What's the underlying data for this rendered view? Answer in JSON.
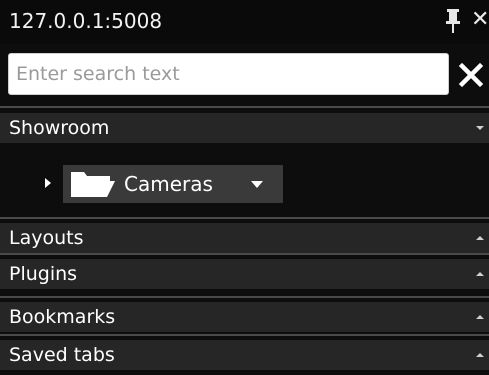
{
  "window": {
    "title": "127.0.0.1:5008",
    "close_glyph": "✕"
  },
  "search": {
    "placeholder": "Enter search text",
    "value": ""
  },
  "sections": {
    "showroom": {
      "label": "Showroom",
      "state": "expanded"
    },
    "layouts": {
      "label": "Layouts",
      "state": "collapsed"
    },
    "plugins": {
      "label": "Plugins",
      "state": "collapsed"
    },
    "bookmarks": {
      "label": "Bookmarks",
      "state": "collapsed"
    },
    "saved_tabs": {
      "label": "Saved tabs",
      "state": "collapsed"
    }
  },
  "tree": {
    "nodes": [
      {
        "label": "Cameras",
        "icon": "folder-icon",
        "expanded": false,
        "selected": true
      }
    ]
  },
  "icons": {
    "pin": "pin-icon",
    "clear": "close-icon",
    "expand": "chevron-down-icon",
    "collapse": "chevron-up-icon",
    "tree_expander": "triangle-right-icon"
  },
  "colors": {
    "background": "#0d0d0d",
    "section_header": "#262626",
    "selected_node": "#3a3a3a",
    "folder": "#ffffff"
  }
}
